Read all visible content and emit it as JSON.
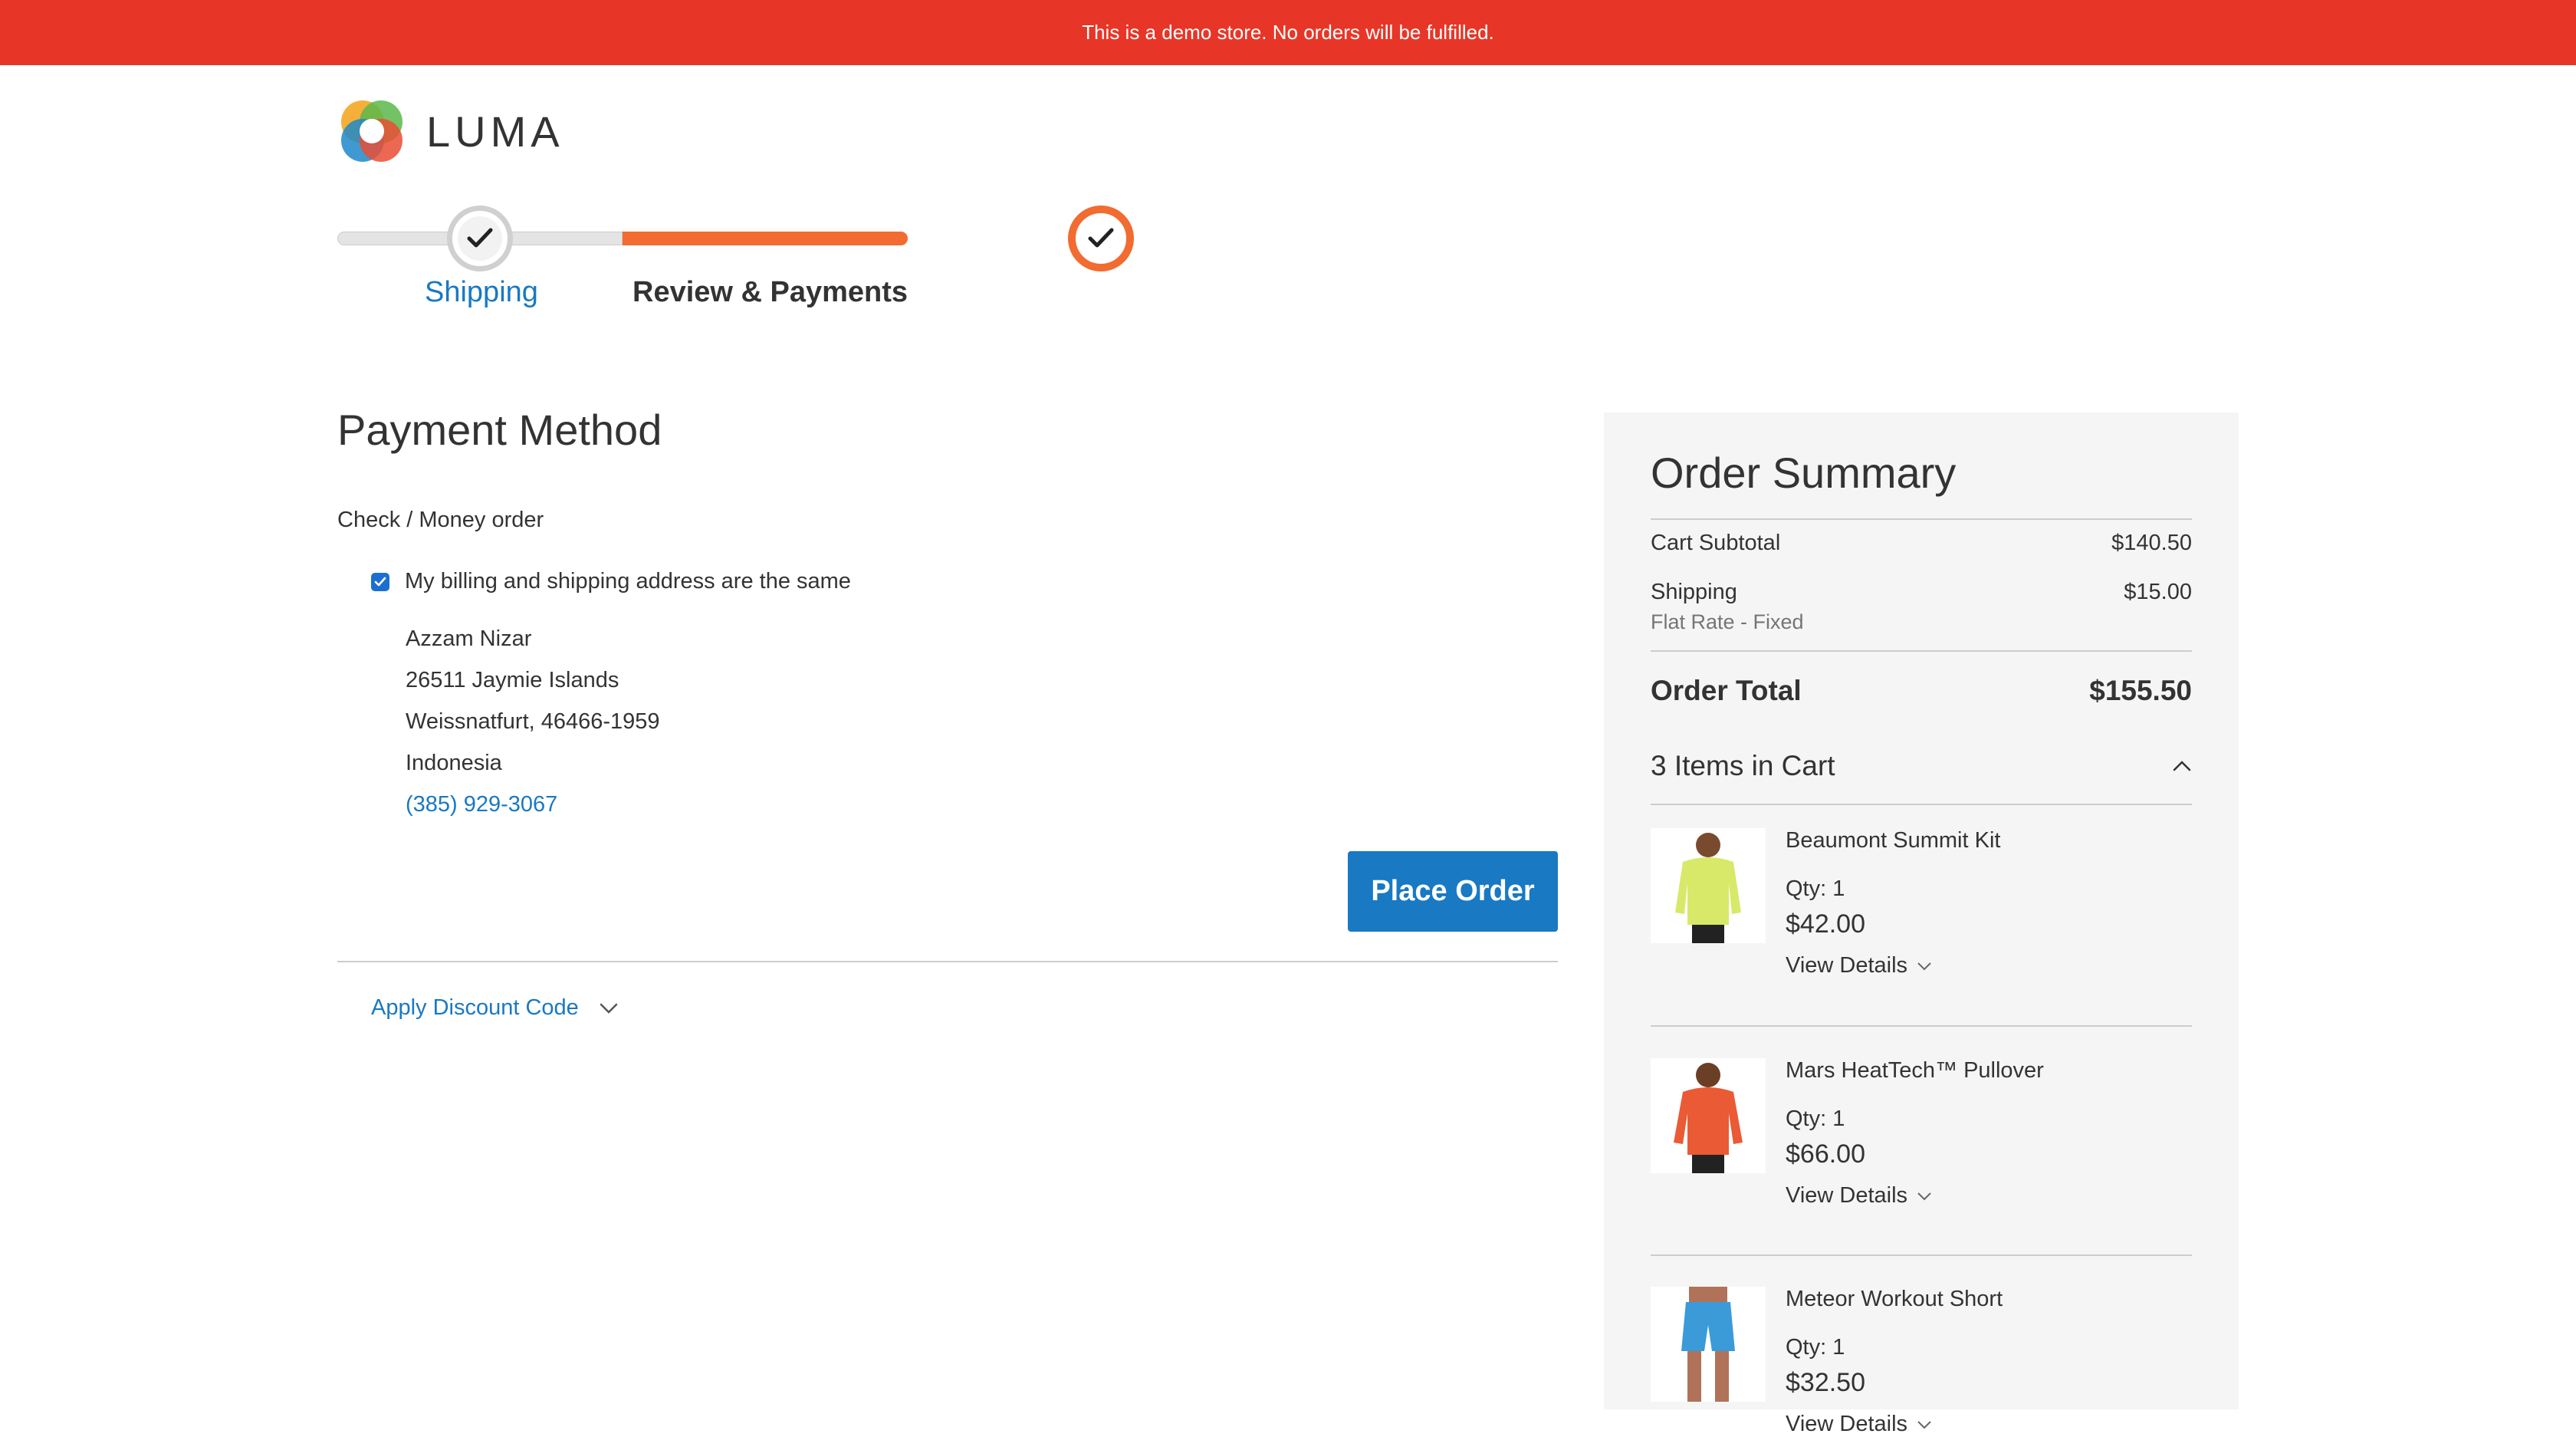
{
  "banner": {
    "text": "This is a demo store. No orders will be fulfilled."
  },
  "header": {
    "logo_text": "LUMA"
  },
  "progress": {
    "steps": [
      {
        "label": "Shipping",
        "state": "complete"
      },
      {
        "label": "Review & Payments",
        "state": "active"
      }
    ]
  },
  "payment": {
    "title": "Payment Method",
    "method_label": "Check / Money order",
    "billing_same_label": "My billing and shipping address are the same",
    "billing_same_checked": true,
    "address": {
      "name": "Azzam Nizar",
      "street": "26511 Jaymie Islands",
      "city_line": "Weissnatfurt, 46466-1959",
      "country": "Indonesia",
      "phone": "(385) 929-3067"
    },
    "place_order_label": "Place Order",
    "discount_label": "Apply Discount Code"
  },
  "summary": {
    "title": "Order Summary",
    "cart_subtotal_label": "Cart Subtotal",
    "cart_subtotal_value": "$140.50",
    "shipping_label": "Shipping",
    "shipping_value": "$15.00",
    "shipping_method": "Flat Rate - Fixed",
    "order_total_label": "Order Total",
    "order_total_value": "$155.50",
    "items_in_cart_label": "3 Items in Cart",
    "items": [
      {
        "name": "Beaumont Summit Kit",
        "qty": "Qty: 1",
        "price": "$42.00",
        "details_label": "View Details",
        "color": "#d8e96a"
      },
      {
        "name": "Mars HeatTech™ Pullover",
        "qty": "Qty: 1",
        "price": "$66.00",
        "details_label": "View Details",
        "color": "#ea5a35"
      },
      {
        "name": "Meteor Workout Short",
        "qty": "Qty: 1",
        "price": "$32.50",
        "details_label": "View Details",
        "color": "#3a9bd8"
      }
    ]
  },
  "colors": {
    "banner": "#e73627",
    "accent_orange": "#f26b30",
    "link_blue": "#1979c3",
    "primary_button": "#1979c3"
  }
}
